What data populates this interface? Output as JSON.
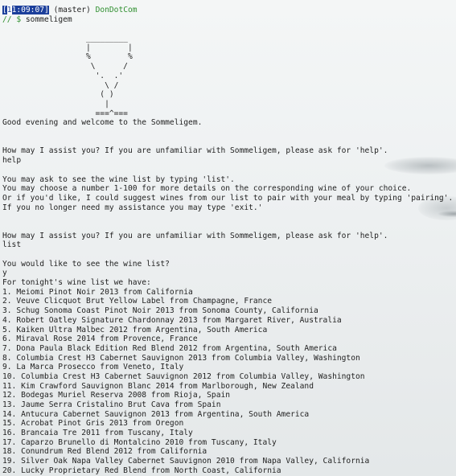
{
  "prompt": {
    "time_first_char": "1",
    "time_rest": "1:09:07",
    "branch": "(master)",
    "host": "DonDotCom",
    "path": "//",
    "symbol": "$",
    "command": "sommeligem"
  },
  "ascii_art": "                  _________\n                  |        |\n                  %        %\n                   \\      /\n                    '.  .'\n                      \\ /\n                     ( )\n                      |\n                    ===^===",
  "welcome": "Good evening and welcome to the Sommeligem.",
  "assist_prompt": "How may I assist you? If you are unfamiliar with Sommeligem, please ask for 'help'.",
  "help_input": "help",
  "help_lines": [
    "You may ask to see the wine list by typing 'list'.",
    "You may choose a number 1-100 for more details on the corresponding wine of your choice.",
    "Or if you'd like, I could suggest wines from our list to pair with your meal by typing 'pairing'.",
    "If you no longer need my assistance you may type 'exit.'"
  ],
  "list_input": "list",
  "confirm_question": "You would like to see the wine list?",
  "confirm_input": "y",
  "wine_list_header": "For tonight's wine list we have:",
  "wines": [
    "1. Meiomi Pinot Noir 2013 from California",
    "2. Veuve Clicquot Brut Yellow Label from Champagne, France",
    "3. Schug Sonoma Coast Pinot Noir 2013 from Sonoma County, California",
    "4. Robert Oatley Signature Chardonnay 2013 from Margaret River, Australia",
    "5. Kaiken Ultra Malbec 2012 from Argentina, South America",
    "6. Miraval Rose 2014 from Provence, France",
    "7. Dona Paula Black Edition Red Blend 2012 from Argentina, South America",
    "8. Columbia Crest H3 Cabernet Sauvignon 2013 from Columbia Valley, Washington",
    "9. La Marca Prosecco from Veneto, Italy",
    "10. Columbia Crest H3 Cabernet Sauvignon 2012 from Columbia Valley, Washington",
    "11. Kim Crawford Sauvignon Blanc 2014 from Marlborough, New Zealand",
    "12. Bodegas Muriel Reserva 2008 from Rioja, Spain",
    "13. Jaume Serra Cristalino Brut Cava from Spain",
    "14. Antucura Cabernet Sauvignon 2013 from Argentina, South America",
    "15. Acrobat Pinot Gris 2013 from Oregon",
    "16. Brancaia Tre 2011 from Tuscany, Italy",
    "17. Caparzo Brunello di Montalcino 2010 from Tuscany, Italy",
    "18. Conundrum Red Blend 2012 from California",
    "19. Silver Oak Napa Valley Cabernet Sauvignon 2010 from Napa Valley, California",
    "20. Lucky Proprietary Red Blend from North Coast, California"
  ],
  "colors": {
    "prompt_green": "#2f8f2f",
    "selection_blue": "#1c3f9b",
    "text": "#222222"
  }
}
